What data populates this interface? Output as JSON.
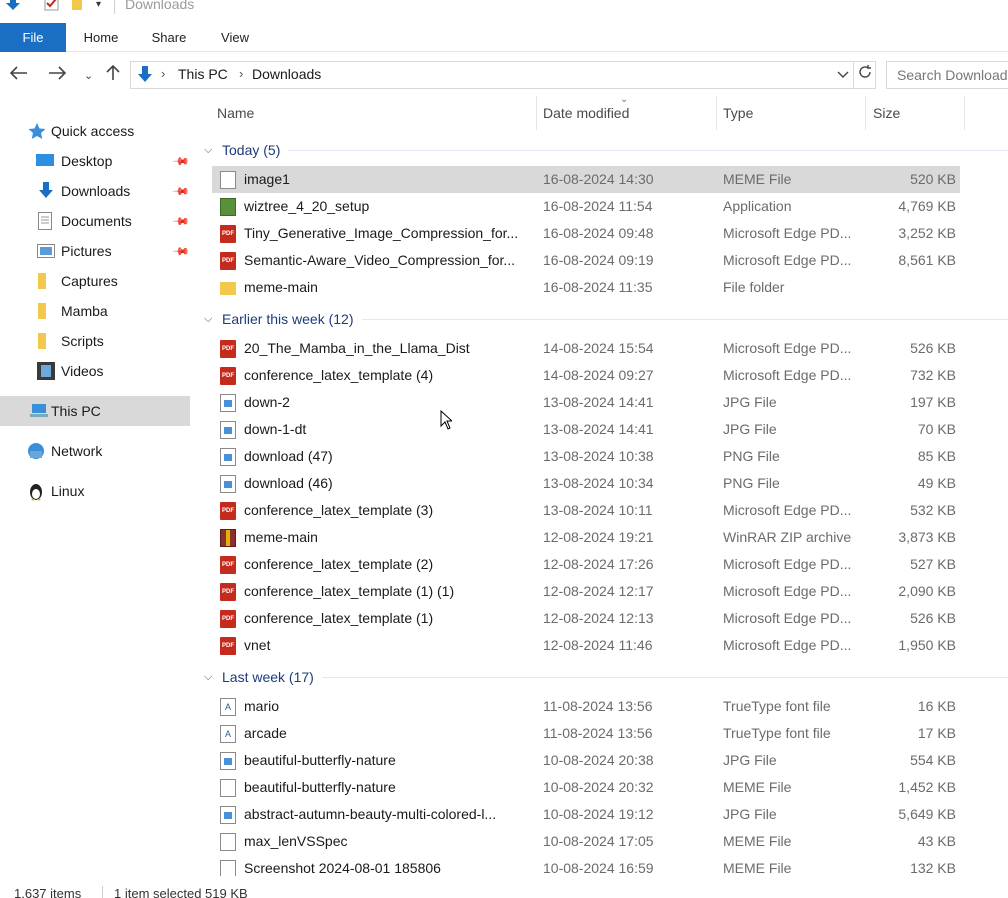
{
  "window": {
    "title": "Downloads"
  },
  "ribbon": {
    "tabs": [
      "File",
      "Home",
      "Share",
      "View"
    ]
  },
  "address": {
    "crumbs": [
      "This PC",
      "Downloads"
    ],
    "search_placeholder": "Search Downloads"
  },
  "sidebar": {
    "items": [
      {
        "label": "Quick access",
        "icon": "star-icon",
        "pinned": false
      },
      {
        "label": "Desktop",
        "icon": "desktop-icon",
        "pinned": true
      },
      {
        "label": "Downloads",
        "icon": "download-arrow-icon",
        "pinned": true
      },
      {
        "label": "Documents",
        "icon": "documents-icon",
        "pinned": true
      },
      {
        "label": "Pictures",
        "icon": "pictures-icon",
        "pinned": true
      },
      {
        "label": "Captures",
        "icon": "folder-icon",
        "pinned": false
      },
      {
        "label": "Mamba",
        "icon": "folder-icon",
        "pinned": false
      },
      {
        "label": "Scripts",
        "icon": "folder-icon",
        "pinned": false
      },
      {
        "label": "Videos",
        "icon": "videos-icon",
        "pinned": false
      },
      {
        "label": "This PC",
        "icon": "computer-icon",
        "pinned": false
      },
      {
        "label": "Network",
        "icon": "network-icon",
        "pinned": false
      },
      {
        "label": "Linux",
        "icon": "linux-penguin-icon",
        "pinned": false
      }
    ]
  },
  "columns": {
    "name": "Name",
    "date": "Date modified",
    "type": "Type",
    "size": "Size"
  },
  "groups": [
    {
      "label": "Today (5)",
      "files": [
        {
          "name": "image1",
          "date": "16-08-2024 14:30",
          "type": "MEME File",
          "size": "520 KB",
          "icon": "file-icon",
          "selected": true
        },
        {
          "name": "wiztree_4_20_setup",
          "date": "16-08-2024 11:54",
          "type": "Application",
          "size": "4,769 KB",
          "icon": "app-icon",
          "selected": false
        },
        {
          "name": "Tiny_Generative_Image_Compression_for...",
          "date": "16-08-2024 09:48",
          "type": "Microsoft Edge PD...",
          "size": "3,252 KB",
          "icon": "pdf-icon",
          "selected": false
        },
        {
          "name": "Semantic-Aware_Video_Compression_for...",
          "date": "16-08-2024 09:19",
          "type": "Microsoft Edge PD...",
          "size": "8,561 KB",
          "icon": "pdf-icon",
          "selected": false
        },
        {
          "name": "meme-main",
          "date": "16-08-2024 11:35",
          "type": "File folder",
          "size": "",
          "icon": "folder-icon",
          "selected": false
        }
      ]
    },
    {
      "label": "Earlier this week (12)",
      "files": [
        {
          "name": "20_The_Mamba_in_the_Llama_Dist",
          "date": "14-08-2024 15:54",
          "type": "Microsoft Edge PD...",
          "size": "526 KB",
          "icon": "pdf-icon",
          "selected": false
        },
        {
          "name": "conference_latex_template (4)",
          "date": "14-08-2024 09:27",
          "type": "Microsoft Edge PD...",
          "size": "732 KB",
          "icon": "pdf-icon",
          "selected": false
        },
        {
          "name": "down-2",
          "date": "13-08-2024 14:41",
          "type": "JPG File",
          "size": "197 KB",
          "icon": "image-icon",
          "selected": false
        },
        {
          "name": "down-1-dt",
          "date": "13-08-2024 14:41",
          "type": "JPG File",
          "size": "70 KB",
          "icon": "image-icon",
          "selected": false
        },
        {
          "name": "download (47)",
          "date": "13-08-2024 10:38",
          "type": "PNG File",
          "size": "85 KB",
          "icon": "image-icon",
          "selected": false
        },
        {
          "name": "download (46)",
          "date": "13-08-2024 10:34",
          "type": "PNG File",
          "size": "49 KB",
          "icon": "image-icon",
          "selected": false
        },
        {
          "name": "conference_latex_template (3)",
          "date": "13-08-2024 10:11",
          "type": "Microsoft Edge PD...",
          "size": "532 KB",
          "icon": "pdf-icon",
          "selected": false
        },
        {
          "name": "meme-main",
          "date": "12-08-2024 19:21",
          "type": "WinRAR ZIP archive",
          "size": "3,873 KB",
          "icon": "zip-icon",
          "selected": false
        },
        {
          "name": "conference_latex_template (2)",
          "date": "12-08-2024 17:26",
          "type": "Microsoft Edge PD...",
          "size": "527 KB",
          "icon": "pdf-icon",
          "selected": false
        },
        {
          "name": "conference_latex_template (1) (1)",
          "date": "12-08-2024 12:17",
          "type": "Microsoft Edge PD...",
          "size": "2,090 KB",
          "icon": "pdf-icon",
          "selected": false
        },
        {
          "name": "conference_latex_template (1)",
          "date": "12-08-2024 12:13",
          "type": "Microsoft Edge PD...",
          "size": "526 KB",
          "icon": "pdf-icon",
          "selected": false
        },
        {
          "name": "vnet",
          "date": "12-08-2024 11:46",
          "type": "Microsoft Edge PD...",
          "size": "1,950 KB",
          "icon": "pdf-icon",
          "selected": false
        }
      ]
    },
    {
      "label": "Last week (17)",
      "files": [
        {
          "name": "mario",
          "date": "11-08-2024 13:56",
          "type": "TrueType font file",
          "size": "16 KB",
          "icon": "font-icon",
          "selected": false
        },
        {
          "name": "arcade",
          "date": "11-08-2024 13:56",
          "type": "TrueType font file",
          "size": "17 KB",
          "icon": "font-icon",
          "selected": false
        },
        {
          "name": "beautiful-butterfly-nature",
          "date": "10-08-2024 20:38",
          "type": "JPG File",
          "size": "554 KB",
          "icon": "image-icon",
          "selected": false
        },
        {
          "name": "beautiful-butterfly-nature",
          "date": "10-08-2024 20:32",
          "type": "MEME File",
          "size": "1,452 KB",
          "icon": "file-icon",
          "selected": false
        },
        {
          "name": "abstract-autumn-beauty-multi-colored-l...",
          "date": "10-08-2024 19:12",
          "type": "JPG File",
          "size": "5,649 KB",
          "icon": "image-icon",
          "selected": false
        },
        {
          "name": "max_lenVSSpec",
          "date": "10-08-2024 17:05",
          "type": "MEME File",
          "size": "43 KB",
          "icon": "file-icon",
          "selected": false
        },
        {
          "name": "Screenshot 2024-08-01 185806",
          "date": "10-08-2024 16:59",
          "type": "MEME File",
          "size": "132 KB",
          "icon": "file-icon",
          "selected": false
        }
      ]
    }
  ],
  "status": {
    "count": "1,637 items",
    "selection": "1 item selected  519 KB"
  },
  "colors": {
    "file_tab": "#1a6fc4",
    "group_header": "#1e3b7a",
    "selection": "#d9d9d9"
  }
}
